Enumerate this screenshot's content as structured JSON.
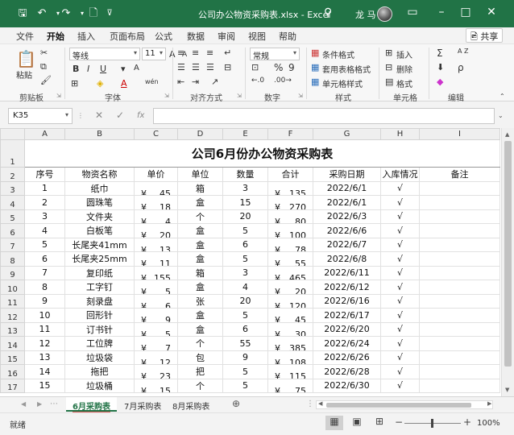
{
  "titlebar": {
    "title": "公司办公物资采购表.xlsx  -  Excel",
    "user": "龙 马",
    "icons": [
      "save-icon",
      "undo-icon",
      "redo-icon",
      "new-file-icon",
      "customize-icon",
      "search-icon",
      "ribbon-display-icon",
      "minimize-icon",
      "restore-icon",
      "close-icon"
    ]
  },
  "ribbon_tabs": [
    "文件",
    "开始",
    "插入",
    "页面布局",
    "公式",
    "数据",
    "审阅",
    "视图",
    "帮助"
  ],
  "active_tab": "开始",
  "share": "🖻 共享",
  "ribbon": {
    "clipboard": {
      "paste": "粘贴",
      "label": "剪贴板"
    },
    "font": {
      "name": "等线",
      "size": "11",
      "label": "字体",
      "bold": "B",
      "italic": "I",
      "underline": "U",
      "grow": "A",
      "shrink": "A",
      "color": "A",
      "wen": "wén"
    },
    "alignment": {
      "label": "对齐方式"
    },
    "number": {
      "format": "常规",
      "percent": "%",
      "comma": "9",
      "label": "数字"
    },
    "styles": {
      "conditional": "条件格式",
      "table": "套用表格格式",
      "cell": "单元格样式",
      "label": "样式"
    },
    "cells": {
      "insert": "插入",
      "delete": "删除",
      "format": "格式",
      "label": "单元格"
    },
    "editing": {
      "label": "编辑",
      "sum": "Σ",
      "sort": "A Z",
      "find": "ρ"
    }
  },
  "formula_bar": {
    "namebox": "K35",
    "cancel": "✕",
    "enter": "✓",
    "fx": "fx",
    "value": ""
  },
  "columns": [
    "A",
    "B",
    "C",
    "D",
    "E",
    "F",
    "G",
    "H",
    "I"
  ],
  "sheet": {
    "title": "公司6月份办公物资采购表",
    "headers": [
      "序号",
      "物资名称",
      "单价",
      "单位",
      "数量",
      "合计",
      "采购日期",
      "入库情况",
      "备注"
    ],
    "currency": "¥",
    "rows": [
      {
        "no": "1",
        "name": "纸巾",
        "price": "45",
        "unit": "箱",
        "qty": "3",
        "total": "135",
        "date": "2022/6/1",
        "status": "√",
        "note": ""
      },
      {
        "no": "2",
        "name": "圆珠笔",
        "price": "18",
        "unit": "盒",
        "qty": "15",
        "total": "270",
        "date": "2022/6/1",
        "status": "√",
        "note": ""
      },
      {
        "no": "3",
        "name": "文件夹",
        "price": "4",
        "unit": "个",
        "qty": "20",
        "total": "80",
        "date": "2022/6/3",
        "status": "√",
        "note": ""
      },
      {
        "no": "4",
        "name": "白板笔",
        "price": "20",
        "unit": "盒",
        "qty": "5",
        "total": "100",
        "date": "2022/6/6",
        "status": "√",
        "note": ""
      },
      {
        "no": "5",
        "name": "长尾夹41mm",
        "price": "13",
        "unit": "盒",
        "qty": "6",
        "total": "78",
        "date": "2022/6/7",
        "status": "√",
        "note": ""
      },
      {
        "no": "6",
        "name": "长尾夹25mm",
        "price": "11",
        "unit": "盒",
        "qty": "5",
        "total": "55",
        "date": "2022/6/8",
        "status": "√",
        "note": ""
      },
      {
        "no": "7",
        "name": "复印纸",
        "price": "155",
        "unit": "箱",
        "qty": "3",
        "total": "465",
        "date": "2022/6/11",
        "status": "√",
        "note": ""
      },
      {
        "no": "8",
        "name": "工字钉",
        "price": "5",
        "unit": "盒",
        "qty": "4",
        "total": "20",
        "date": "2022/6/12",
        "status": "√",
        "note": ""
      },
      {
        "no": "9",
        "name": "刻录盘",
        "price": "6",
        "unit": "张",
        "qty": "20",
        "total": "120",
        "date": "2022/6/16",
        "status": "√",
        "note": ""
      },
      {
        "no": "10",
        "name": "回形针",
        "price": "9",
        "unit": "盒",
        "qty": "5",
        "total": "45",
        "date": "2022/6/17",
        "status": "√",
        "note": ""
      },
      {
        "no": "11",
        "name": "订书针",
        "price": "5",
        "unit": "盒",
        "qty": "6",
        "total": "30",
        "date": "2022/6/20",
        "status": "√",
        "note": ""
      },
      {
        "no": "12",
        "name": "工位牌",
        "price": "7",
        "unit": "个",
        "qty": "55",
        "total": "385",
        "date": "2022/6/24",
        "status": "√",
        "note": ""
      },
      {
        "no": "13",
        "name": "垃圾袋",
        "price": "12",
        "unit": "包",
        "qty": "9",
        "total": "108",
        "date": "2022/6/26",
        "status": "√",
        "note": ""
      },
      {
        "no": "14",
        "name": "拖把",
        "price": "23",
        "unit": "把",
        "qty": "5",
        "total": "115",
        "date": "2022/6/28",
        "status": "√",
        "note": ""
      },
      {
        "no": "15",
        "name": "垃圾桶",
        "price": "15",
        "unit": "个",
        "qty": "5",
        "total": "75",
        "date": "2022/6/30",
        "status": "√",
        "note": ""
      }
    ]
  },
  "sheet_tabs": [
    "6月采购表",
    "7月采购表",
    "8月采购表"
  ],
  "active_sheet": "6月采购表",
  "status": {
    "text": "就绪",
    "zoom": "100%",
    "zoom_minus": "−",
    "zoom_plus": "+"
  },
  "colors": {
    "accent": "#217346",
    "active_sheet_underline": "#e06060"
  }
}
